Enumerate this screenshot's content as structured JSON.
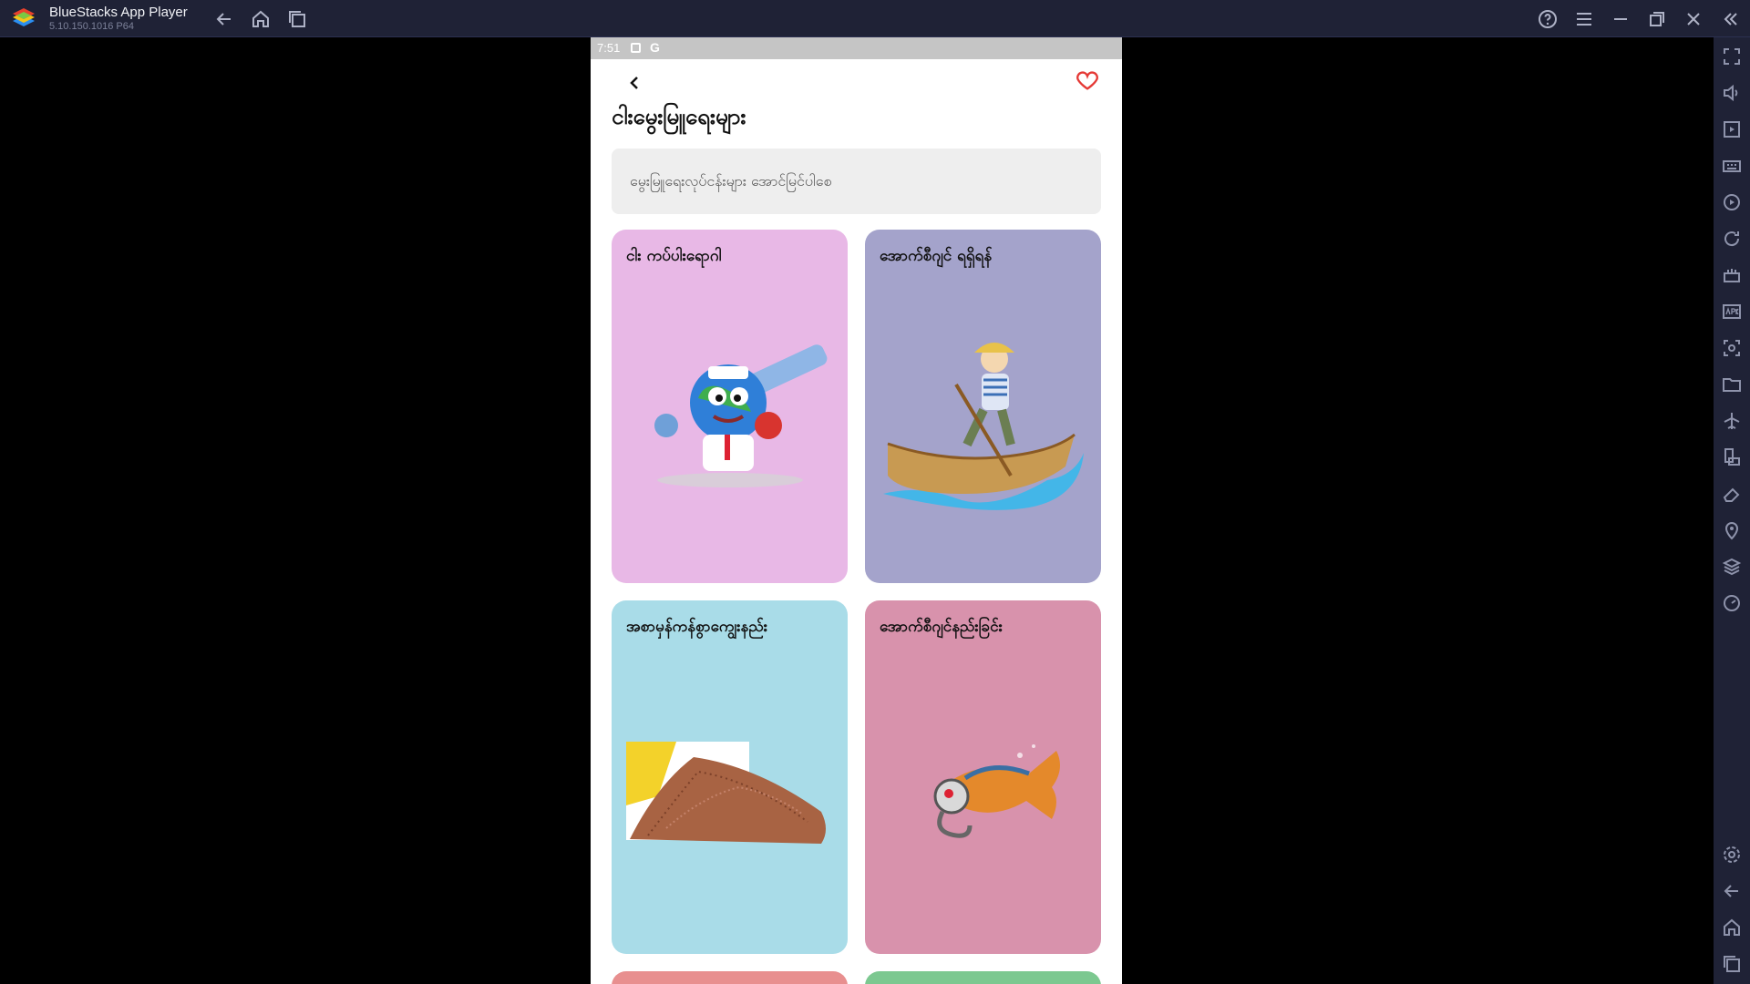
{
  "window": {
    "title": "BlueStacks App Player",
    "version": "5.10.150.1016  P64"
  },
  "status_bar": {
    "time": "7:51",
    "g_label": "G"
  },
  "page": {
    "title": "ငါးမွေးမြူရေးများ",
    "search_placeholder": "မွေးမြူရေးလုပ်ငန်းများ အောင်မြင်ပါစေ"
  },
  "cards": [
    {
      "label": "ငါး ကပ်ပါးရောဂါ",
      "color": "#e8b8e6",
      "image": "globe-doctor-syringe"
    },
    {
      "label": "အောက်စီဂျင် ရရှိရန်",
      "color": "#a4a3cb",
      "image": "boy-rowing-boat"
    },
    {
      "label": "အစာမှန်ကန်စွာကျွေးနည်း",
      "color": "#a9dce8",
      "image": "fish-feed-pellets"
    },
    {
      "label": "အောက်စီဂျင်နည်းခြင်း",
      "color": "#d892ac",
      "image": "fish-with-gas-mask"
    }
  ],
  "accent_colors": {
    "favorite": "#e53935",
    "titlebar": "#1f2236"
  }
}
